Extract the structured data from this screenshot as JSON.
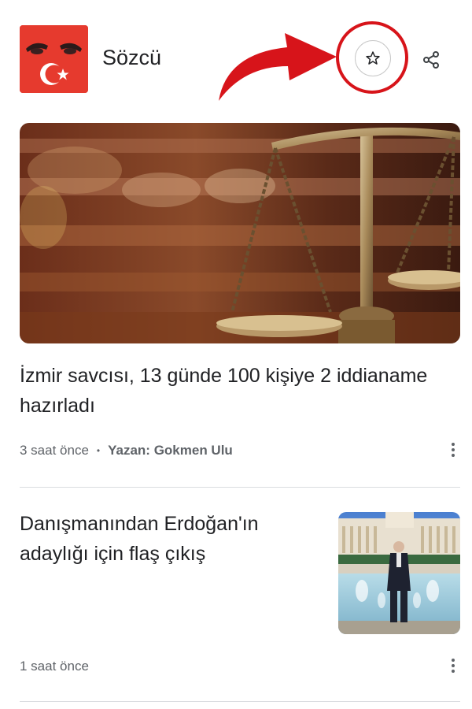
{
  "header": {
    "source_name": "Sözcü",
    "follow_icon": "star-outline-icon",
    "share_icon": "share-icon",
    "annotation_color": "#d7141a"
  },
  "articles": [
    {
      "title": "İzmir savcısı, 13 günde 100 kişiye 2 iddianame hazırladı",
      "time": "3 saat önce",
      "separator": "•",
      "author": "Yazan: Gokmen Ulu",
      "image": "scales-of-justice-photo"
    },
    {
      "title": "Danışmanından Erdoğan'ın adaylığı için flaş çıkış",
      "time": "1 saat önce",
      "image": "palace-fountain-photo"
    }
  ],
  "colors": {
    "logo_bg": "#e63a2e",
    "text_primary": "#202124",
    "text_secondary": "#5f6368",
    "divider": "#dadce0"
  }
}
